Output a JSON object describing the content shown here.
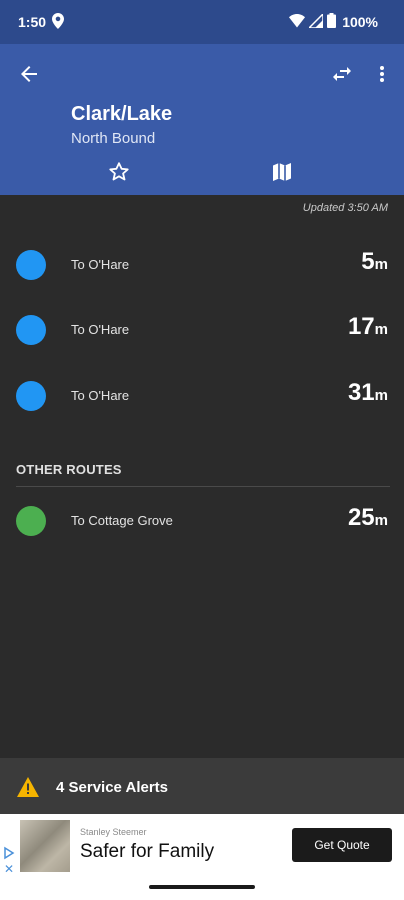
{
  "status_bar": {
    "time": "1:50",
    "battery": "100%"
  },
  "header": {
    "title": "Clark/Lake",
    "subtitle": "North Bound"
  },
  "updated": "Updated 3:50 AM",
  "arrivals": [
    {
      "destination": "To O'Hare",
      "eta": "5",
      "unit": "m",
      "color": "#2196f3"
    },
    {
      "destination": "To O'Hare",
      "eta": "17",
      "unit": "m",
      "color": "#2196f3"
    },
    {
      "destination": "To O'Hare",
      "eta": "31",
      "unit": "m",
      "color": "#2196f3"
    }
  ],
  "other_routes": {
    "title": "OTHER ROUTES",
    "items": [
      {
        "destination": "To Cottage Grove",
        "eta": "25",
        "unit": "m",
        "color": "#4caf50"
      }
    ]
  },
  "alerts": {
    "label": "4 Service Alerts"
  },
  "ad": {
    "sponsor": "Stanley Steemer",
    "headline": "Safer for Family",
    "cta": "Get Quote"
  },
  "icons": {
    "back": "back-arrow-icon",
    "swap": "swap-direction-icon",
    "more": "more-vert-icon",
    "favorite": "star-outline-icon",
    "map": "map-icon",
    "warning": "warning-icon"
  }
}
